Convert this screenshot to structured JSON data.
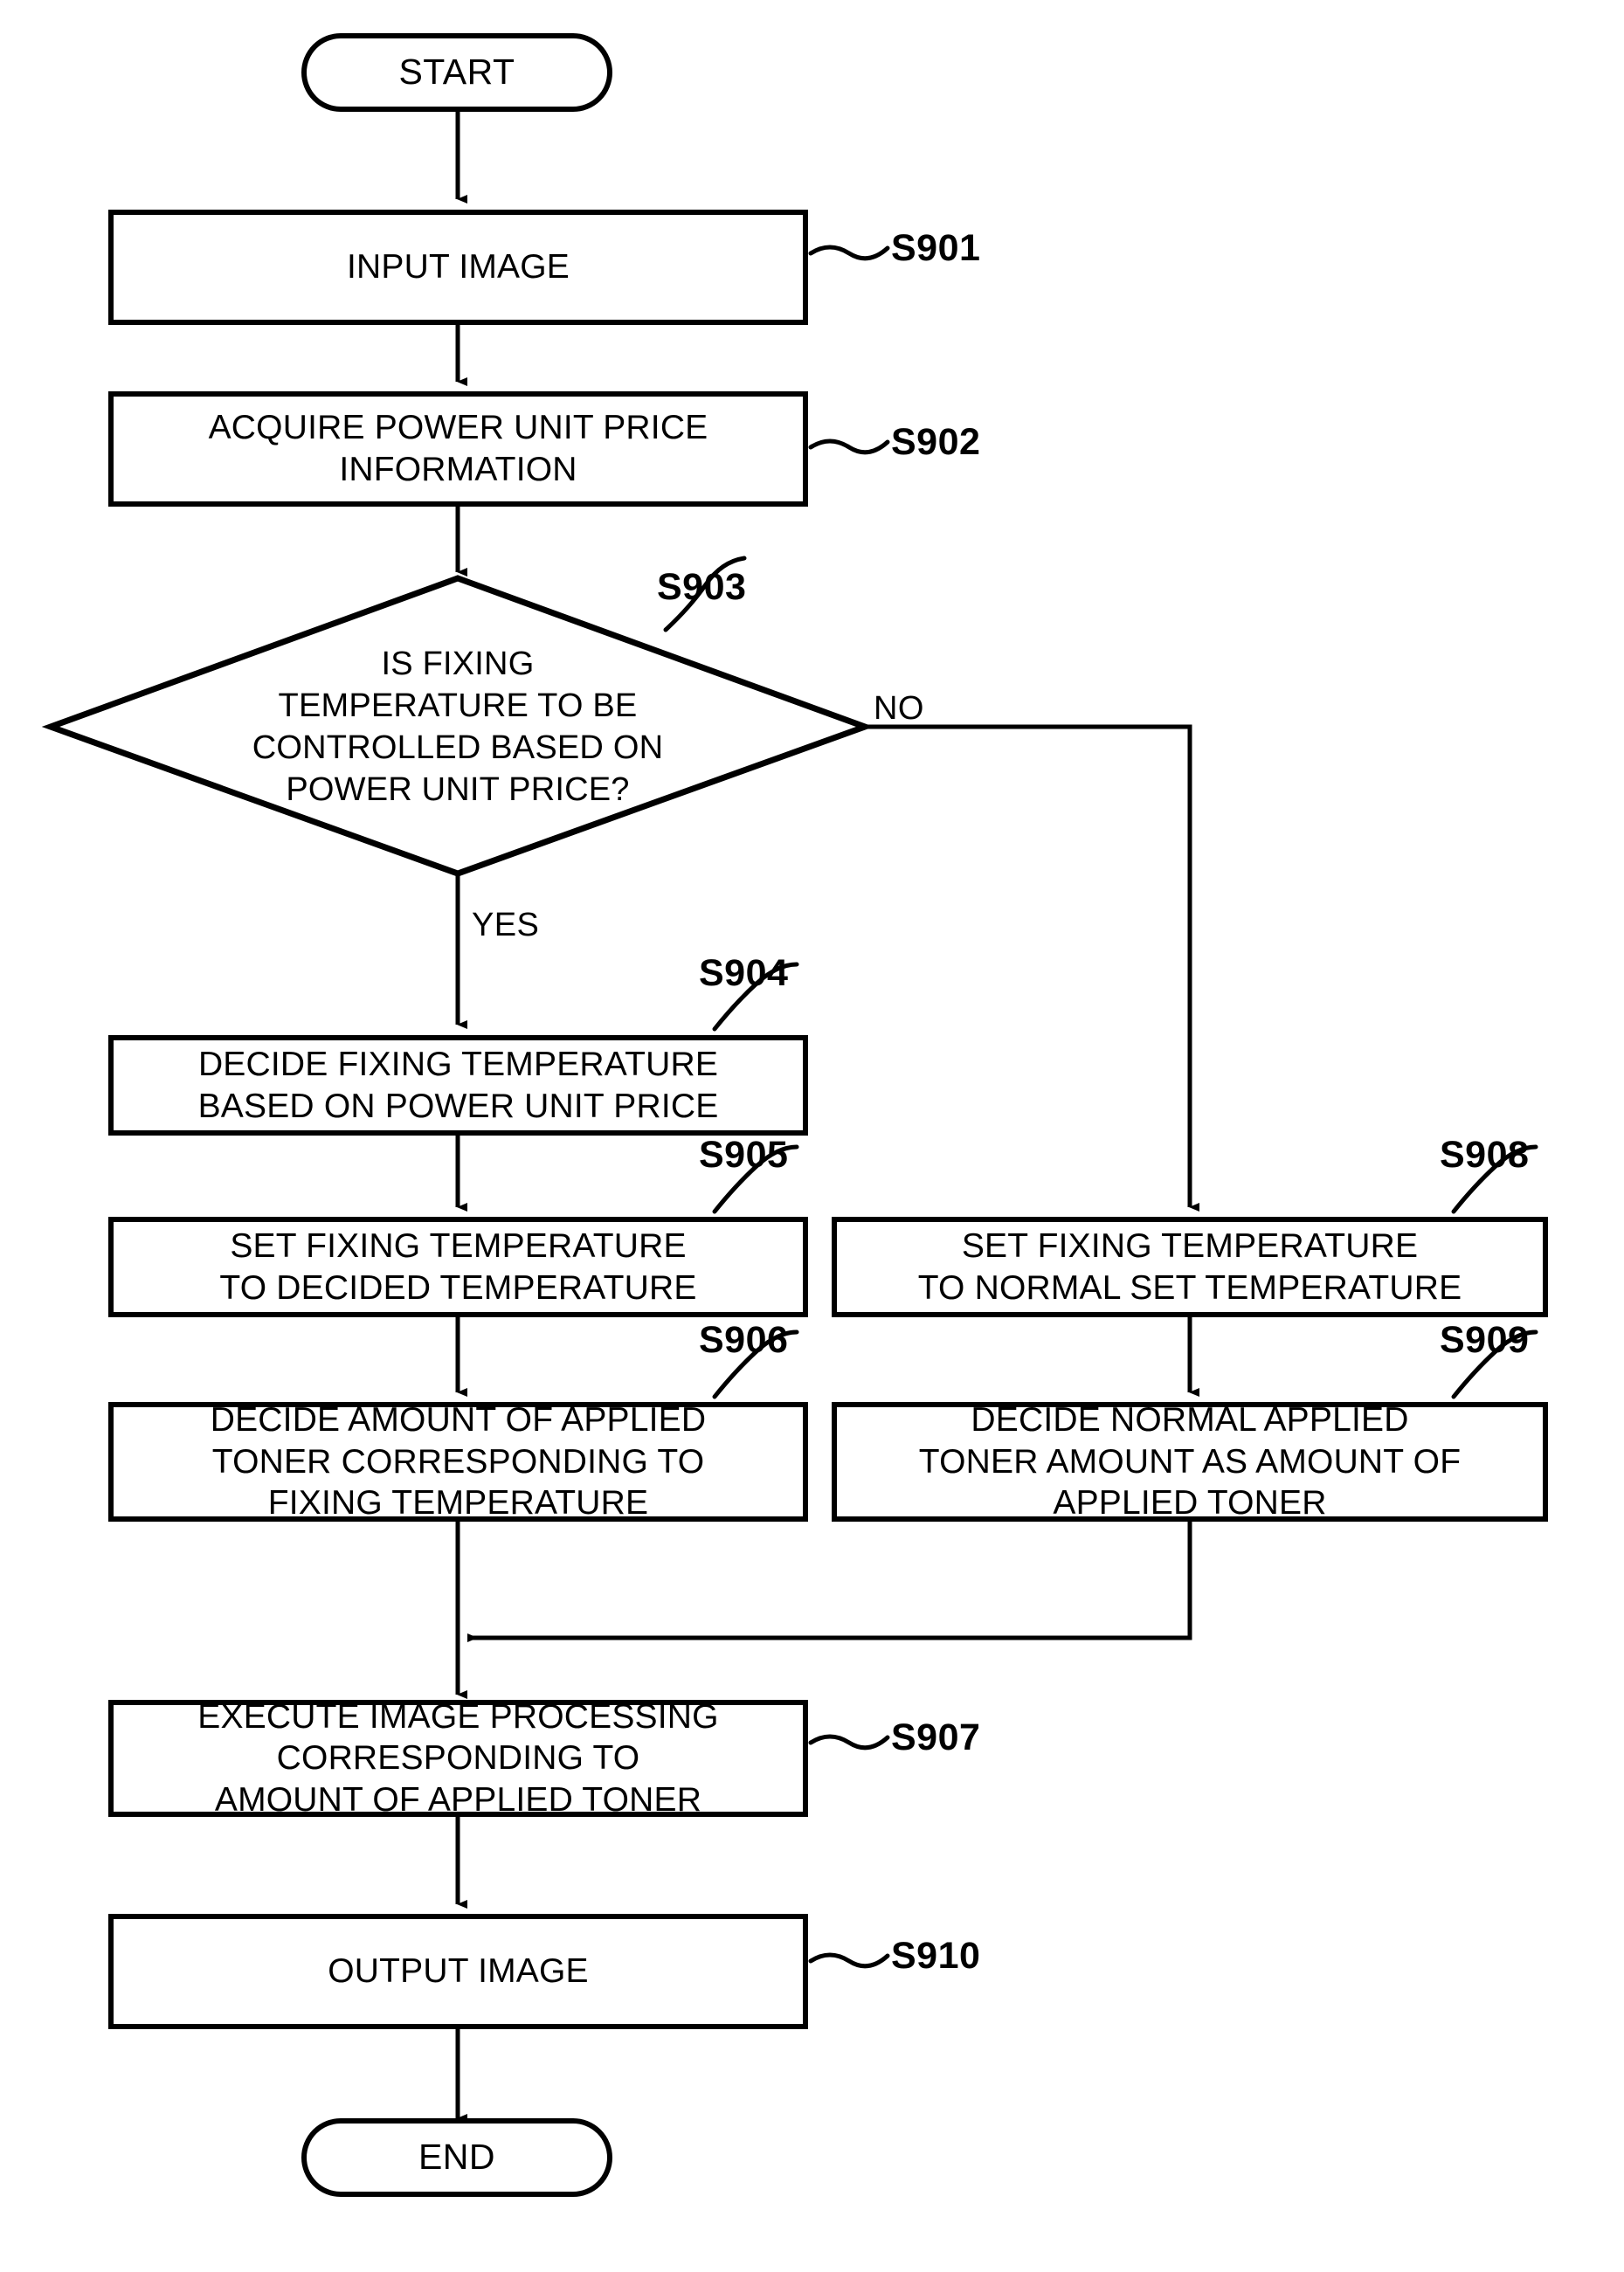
{
  "diagram": {
    "title": "Fixing temperature control flowchart",
    "stroke_color": "#000000",
    "background_color": "#ffffff"
  },
  "nodes": {
    "start": {
      "label": "START",
      "shape": "terminator"
    },
    "end": {
      "label": "END",
      "shape": "terminator"
    },
    "s901": {
      "label": "INPUT IMAGE",
      "step": "S901",
      "shape": "process"
    },
    "s902": {
      "label": "ACQUIRE POWER UNIT PRICE\nINFORMATION",
      "step": "S902",
      "shape": "process"
    },
    "s903": {
      "label": "IS FIXING\nTEMPERATURE TO BE\nCONTROLLED BASED ON\nPOWER UNIT PRICE?",
      "step": "S903",
      "shape": "decision"
    },
    "s904": {
      "label": "DECIDE FIXING TEMPERATURE\nBASED ON POWER UNIT PRICE",
      "step": "S904",
      "shape": "process"
    },
    "s905": {
      "label": "SET FIXING TEMPERATURE\nTO DECIDED TEMPERATURE",
      "step": "S905",
      "shape": "process"
    },
    "s906": {
      "label": "DECIDE AMOUNT OF APPLIED\nTONER CORRESPONDING TO\nFIXING TEMPERATURE",
      "step": "S906",
      "shape": "process"
    },
    "s907": {
      "label": "EXECUTE IMAGE PROCESSING\nCORRESPONDING TO\nAMOUNT OF APPLIED TONER",
      "step": "S907",
      "shape": "process"
    },
    "s908": {
      "label": "SET FIXING TEMPERATURE\nTO NORMAL SET TEMPERATURE",
      "step": "S908",
      "shape": "process"
    },
    "s909": {
      "label": "DECIDE NORMAL APPLIED\nTONER AMOUNT AS AMOUNT OF\nAPPLIED TONER",
      "step": "S909",
      "shape": "process"
    },
    "s910": {
      "label": "OUTPUT IMAGE",
      "step": "S910",
      "shape": "process"
    }
  },
  "branches": {
    "yes": "YES",
    "no": "NO"
  }
}
